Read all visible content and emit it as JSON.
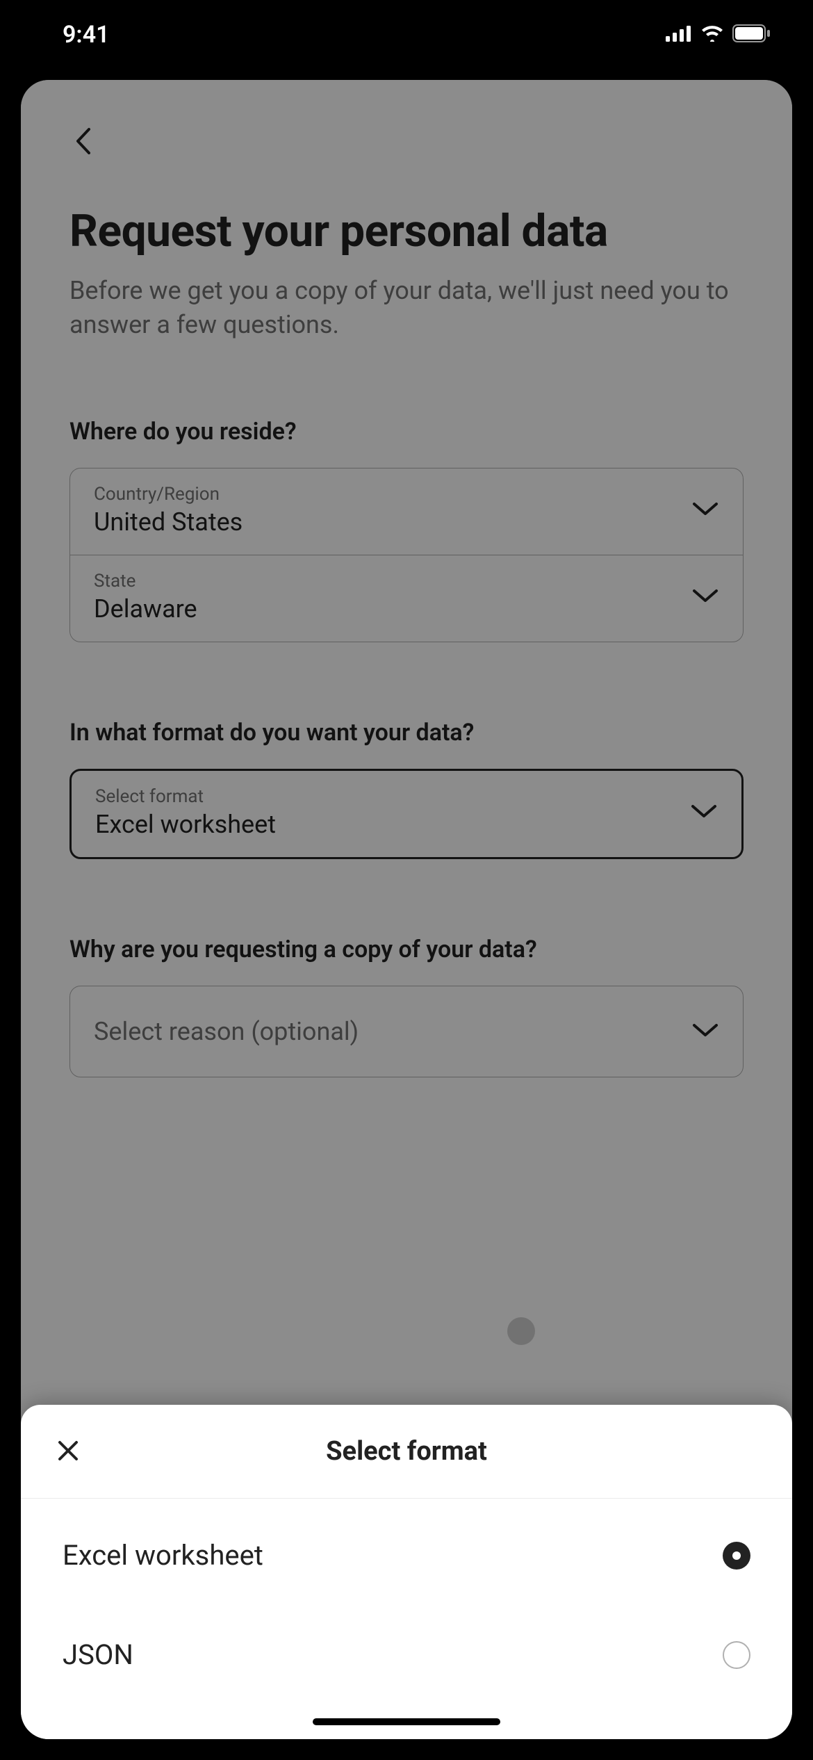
{
  "status": {
    "time": "9:41"
  },
  "page": {
    "title": "Request your personal data",
    "subtitle": "Before we get you a copy of your data, we'll just need you to answer a few questions."
  },
  "sections": {
    "reside": {
      "label": "Where do you reside?",
      "country_label": "Country/Region",
      "country_value": "United States",
      "state_label": "State",
      "state_value": "Delaware"
    },
    "format": {
      "label": "In what format do you want your data?",
      "field_label": "Select format",
      "field_value": "Excel worksheet"
    },
    "reason": {
      "label": "Why are you requesting a copy of your data?",
      "placeholder": "Select reason (optional)"
    }
  },
  "sheet": {
    "title": "Select format",
    "options": [
      {
        "label": "Excel worksheet",
        "selected": true
      },
      {
        "label": "JSON",
        "selected": false
      }
    ]
  }
}
